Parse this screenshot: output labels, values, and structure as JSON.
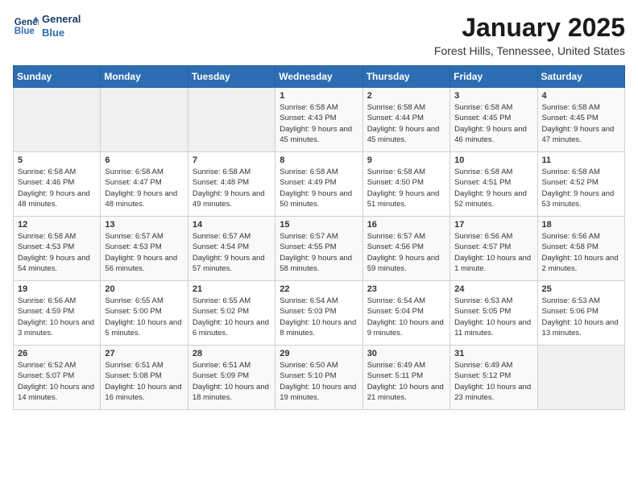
{
  "header": {
    "logo_line1": "General",
    "logo_line2": "Blue",
    "month": "January 2025",
    "location": "Forest Hills, Tennessee, United States"
  },
  "weekdays": [
    "Sunday",
    "Monday",
    "Tuesday",
    "Wednesday",
    "Thursday",
    "Friday",
    "Saturday"
  ],
  "weeks": [
    [
      {
        "day": "",
        "sunrise": "",
        "sunset": "",
        "daylight": ""
      },
      {
        "day": "",
        "sunrise": "",
        "sunset": "",
        "daylight": ""
      },
      {
        "day": "",
        "sunrise": "",
        "sunset": "",
        "daylight": ""
      },
      {
        "day": "1",
        "sunrise": "Sunrise: 6:58 AM",
        "sunset": "Sunset: 4:43 PM",
        "daylight": "Daylight: 9 hours and 45 minutes."
      },
      {
        "day": "2",
        "sunrise": "Sunrise: 6:58 AM",
        "sunset": "Sunset: 4:44 PM",
        "daylight": "Daylight: 9 hours and 45 minutes."
      },
      {
        "day": "3",
        "sunrise": "Sunrise: 6:58 AM",
        "sunset": "Sunset: 4:45 PM",
        "daylight": "Daylight: 9 hours and 46 minutes."
      },
      {
        "day": "4",
        "sunrise": "Sunrise: 6:58 AM",
        "sunset": "Sunset: 4:45 PM",
        "daylight": "Daylight: 9 hours and 47 minutes."
      }
    ],
    [
      {
        "day": "5",
        "sunrise": "Sunrise: 6:58 AM",
        "sunset": "Sunset: 4:46 PM",
        "daylight": "Daylight: 9 hours and 48 minutes."
      },
      {
        "day": "6",
        "sunrise": "Sunrise: 6:58 AM",
        "sunset": "Sunset: 4:47 PM",
        "daylight": "Daylight: 9 hours and 48 minutes."
      },
      {
        "day": "7",
        "sunrise": "Sunrise: 6:58 AM",
        "sunset": "Sunset: 4:48 PM",
        "daylight": "Daylight: 9 hours and 49 minutes."
      },
      {
        "day": "8",
        "sunrise": "Sunrise: 6:58 AM",
        "sunset": "Sunset: 4:49 PM",
        "daylight": "Daylight: 9 hours and 50 minutes."
      },
      {
        "day": "9",
        "sunrise": "Sunrise: 6:58 AM",
        "sunset": "Sunset: 4:50 PM",
        "daylight": "Daylight: 9 hours and 51 minutes."
      },
      {
        "day": "10",
        "sunrise": "Sunrise: 6:58 AM",
        "sunset": "Sunset: 4:51 PM",
        "daylight": "Daylight: 9 hours and 52 minutes."
      },
      {
        "day": "11",
        "sunrise": "Sunrise: 6:58 AM",
        "sunset": "Sunset: 4:52 PM",
        "daylight": "Daylight: 9 hours and 53 minutes."
      }
    ],
    [
      {
        "day": "12",
        "sunrise": "Sunrise: 6:58 AM",
        "sunset": "Sunset: 4:53 PM",
        "daylight": "Daylight: 9 hours and 54 minutes."
      },
      {
        "day": "13",
        "sunrise": "Sunrise: 6:57 AM",
        "sunset": "Sunset: 4:53 PM",
        "daylight": "Daylight: 9 hours and 56 minutes."
      },
      {
        "day": "14",
        "sunrise": "Sunrise: 6:57 AM",
        "sunset": "Sunset: 4:54 PM",
        "daylight": "Daylight: 9 hours and 57 minutes."
      },
      {
        "day": "15",
        "sunrise": "Sunrise: 6:57 AM",
        "sunset": "Sunset: 4:55 PM",
        "daylight": "Daylight: 9 hours and 58 minutes."
      },
      {
        "day": "16",
        "sunrise": "Sunrise: 6:57 AM",
        "sunset": "Sunset: 4:56 PM",
        "daylight": "Daylight: 9 hours and 59 minutes."
      },
      {
        "day": "17",
        "sunrise": "Sunrise: 6:56 AM",
        "sunset": "Sunset: 4:57 PM",
        "daylight": "Daylight: 10 hours and 1 minute."
      },
      {
        "day": "18",
        "sunrise": "Sunrise: 6:56 AM",
        "sunset": "Sunset: 4:58 PM",
        "daylight": "Daylight: 10 hours and 2 minutes."
      }
    ],
    [
      {
        "day": "19",
        "sunrise": "Sunrise: 6:56 AM",
        "sunset": "Sunset: 4:59 PM",
        "daylight": "Daylight: 10 hours and 3 minutes."
      },
      {
        "day": "20",
        "sunrise": "Sunrise: 6:55 AM",
        "sunset": "Sunset: 5:00 PM",
        "daylight": "Daylight: 10 hours and 5 minutes."
      },
      {
        "day": "21",
        "sunrise": "Sunrise: 6:55 AM",
        "sunset": "Sunset: 5:02 PM",
        "daylight": "Daylight: 10 hours and 6 minutes."
      },
      {
        "day": "22",
        "sunrise": "Sunrise: 6:54 AM",
        "sunset": "Sunset: 5:03 PM",
        "daylight": "Daylight: 10 hours and 8 minutes."
      },
      {
        "day": "23",
        "sunrise": "Sunrise: 6:54 AM",
        "sunset": "Sunset: 5:04 PM",
        "daylight": "Daylight: 10 hours and 9 minutes."
      },
      {
        "day": "24",
        "sunrise": "Sunrise: 6:53 AM",
        "sunset": "Sunset: 5:05 PM",
        "daylight": "Daylight: 10 hours and 11 minutes."
      },
      {
        "day": "25",
        "sunrise": "Sunrise: 6:53 AM",
        "sunset": "Sunset: 5:06 PM",
        "daylight": "Daylight: 10 hours and 13 minutes."
      }
    ],
    [
      {
        "day": "26",
        "sunrise": "Sunrise: 6:52 AM",
        "sunset": "Sunset: 5:07 PM",
        "daylight": "Daylight: 10 hours and 14 minutes."
      },
      {
        "day": "27",
        "sunrise": "Sunrise: 6:51 AM",
        "sunset": "Sunset: 5:08 PM",
        "daylight": "Daylight: 10 hours and 16 minutes."
      },
      {
        "day": "28",
        "sunrise": "Sunrise: 6:51 AM",
        "sunset": "Sunset: 5:09 PM",
        "daylight": "Daylight: 10 hours and 18 minutes."
      },
      {
        "day": "29",
        "sunrise": "Sunrise: 6:50 AM",
        "sunset": "Sunset: 5:10 PM",
        "daylight": "Daylight: 10 hours and 19 minutes."
      },
      {
        "day": "30",
        "sunrise": "Sunrise: 6:49 AM",
        "sunset": "Sunset: 5:11 PM",
        "daylight": "Daylight: 10 hours and 21 minutes."
      },
      {
        "day": "31",
        "sunrise": "Sunrise: 6:49 AM",
        "sunset": "Sunset: 5:12 PM",
        "daylight": "Daylight: 10 hours and 23 minutes."
      },
      {
        "day": "",
        "sunrise": "",
        "sunset": "",
        "daylight": ""
      }
    ]
  ]
}
